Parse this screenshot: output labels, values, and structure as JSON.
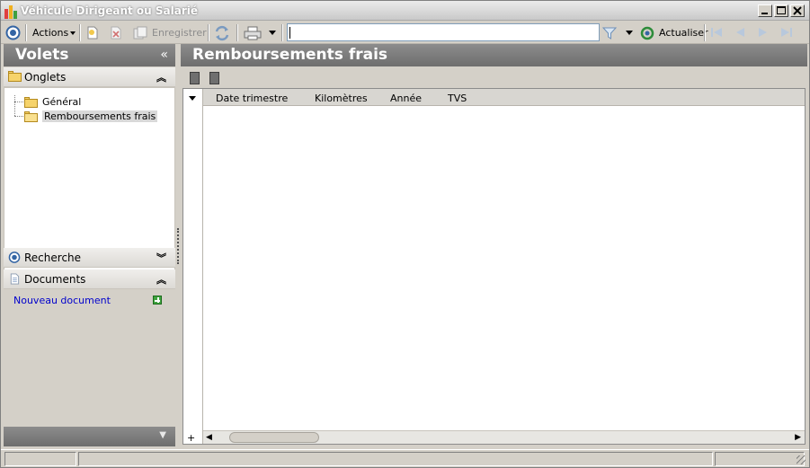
{
  "window": {
    "title": "Véhicule Dirigeant ou Salarié"
  },
  "toolbar": {
    "actions_label": "Actions",
    "save_label": "Enregistrer",
    "search_value": "",
    "refresh_label": "Actualiser"
  },
  "left_panel": {
    "title": "Volets",
    "tabs_section": {
      "label": "Onglets",
      "items": [
        {
          "label": "Général",
          "selected": false
        },
        {
          "label": "Remboursements frais",
          "selected": true
        }
      ]
    },
    "search_section": {
      "label": "Recherche"
    },
    "documents_section": {
      "label": "Documents",
      "new_document_link": "Nouveau document"
    }
  },
  "main": {
    "title": "Remboursements frais",
    "grid": {
      "columns": [
        "Date trimestre",
        "Kilomètres",
        "Année",
        "TVS"
      ],
      "rows": []
    }
  },
  "colors": {
    "header_gray": "#7a7a7a",
    "link_blue": "#0000cc",
    "window_bg": "#d4d0c8"
  }
}
